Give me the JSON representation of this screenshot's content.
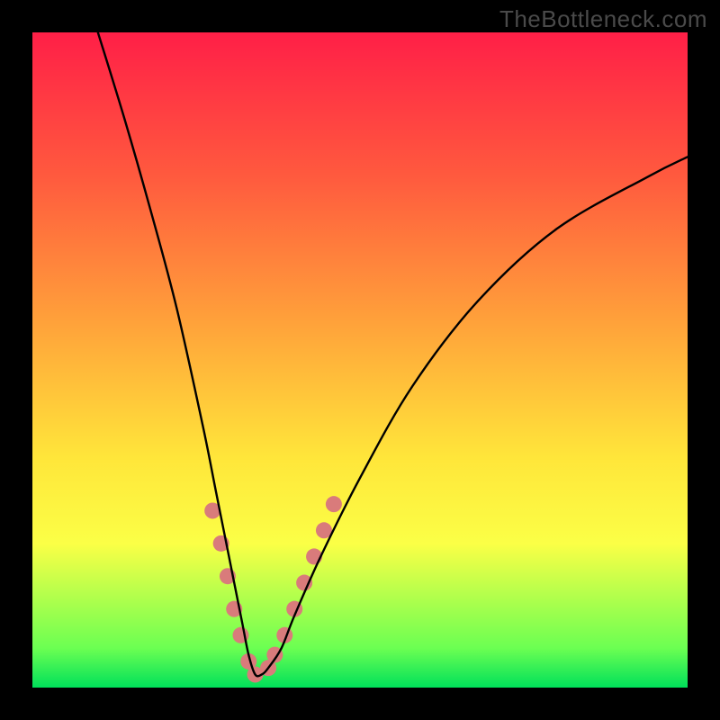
{
  "watermark": "TheBottleneck.com",
  "chart_data": {
    "type": "line",
    "title": "",
    "xlabel": "",
    "ylabel": "",
    "xlim": [
      0,
      100
    ],
    "ylim": [
      0,
      100
    ],
    "description": "Bottleneck-style V curve over a vertical red-to-green gradient. The black line descends steeply from top-left, reaches a minimum near x≈34 at the bottom, then rises more gently toward the upper-right. Salmon dots highlight the near-minimum region on both arms.",
    "series": [
      {
        "name": "curve",
        "color": "#000000",
        "x": [
          10,
          14,
          18,
          22,
          26,
          28,
          30,
          32,
          33,
          34,
          35,
          36,
          38,
          40,
          44,
          50,
          58,
          68,
          80,
          94,
          100
        ],
        "y": [
          100,
          87,
          73,
          58,
          40,
          30,
          20,
          10,
          5,
          2,
          2,
          3,
          6,
          11,
          20,
          32,
          46,
          59,
          70,
          78,
          81
        ]
      }
    ],
    "highlight_dots": {
      "color": "#d97b7b",
      "radius_px": 9,
      "points": [
        {
          "x": 27.5,
          "y": 27
        },
        {
          "x": 28.8,
          "y": 22
        },
        {
          "x": 29.8,
          "y": 17
        },
        {
          "x": 30.8,
          "y": 12
        },
        {
          "x": 31.8,
          "y": 8
        },
        {
          "x": 33.0,
          "y": 4
        },
        {
          "x": 34.0,
          "y": 2
        },
        {
          "x": 36.0,
          "y": 3
        },
        {
          "x": 37.0,
          "y": 5
        },
        {
          "x": 38.5,
          "y": 8
        },
        {
          "x": 40.0,
          "y": 12
        },
        {
          "x": 41.5,
          "y": 16
        },
        {
          "x": 43.0,
          "y": 20
        },
        {
          "x": 44.5,
          "y": 24
        },
        {
          "x": 46.0,
          "y": 28
        }
      ]
    }
  }
}
